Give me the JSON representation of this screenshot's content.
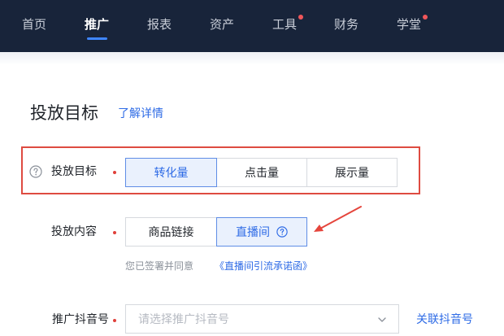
{
  "nav": {
    "items": [
      {
        "label": "首页"
      },
      {
        "label": "推广"
      },
      {
        "label": "报表"
      },
      {
        "label": "资产"
      },
      {
        "label": "工具"
      },
      {
        "label": "财务"
      },
      {
        "label": "学堂"
      }
    ]
  },
  "section": {
    "title": "投放目标",
    "learn_more": "了解详情"
  },
  "goal": {
    "label": "投放目标",
    "options": [
      "转化量",
      "点击量",
      "展示量"
    ],
    "selected": "转化量"
  },
  "content": {
    "label": "投放内容",
    "options": [
      "商品链接",
      "直播间"
    ],
    "selected": "直播间"
  },
  "agreement": {
    "text": "您已签署并同意",
    "link": "《直播间引流承诺函》"
  },
  "douyin": {
    "label": "推广抖音号",
    "placeholder": "请选择推广抖音号",
    "link": "关联抖音号"
  },
  "colors": {
    "nav_bg": "#18243a",
    "accent": "#2e6be6",
    "highlight_border": "#de4b41",
    "annotation_arrow": "#e5453c"
  },
  "icons": {
    "help": "question-circle-icon",
    "dropdown": "chevron-down-icon",
    "annotation": "arrow-annotation-icon"
  }
}
